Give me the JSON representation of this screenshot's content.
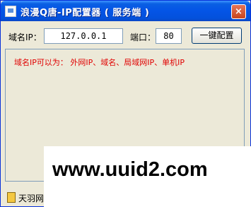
{
  "window": {
    "title": "浪漫Q唐-IP配置器 ( 服务端 )",
    "close_label": "×"
  },
  "form": {
    "domain_ip_label": "域名IP：",
    "domain_ip_value": "127.0.0.1",
    "port_label": "端口：",
    "port_value": "80",
    "one_click_label": "一键配置"
  },
  "info": {
    "text": "域名IP可以为： 外网IP、域名、局域网IP、单机IP"
  },
  "status": {
    "text": "天羽网"
  },
  "watermark": {
    "text": "www.uuid2.com"
  },
  "colors": {
    "titlebar": "#0454e6",
    "info_text": "#e00000",
    "window_bg": "#ece9d8"
  }
}
